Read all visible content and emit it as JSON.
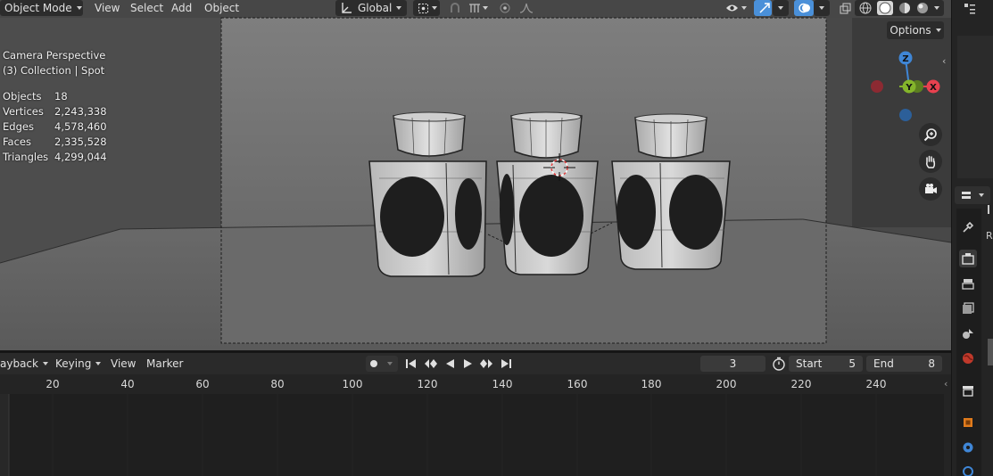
{
  "header": {
    "mode": "Object Mode",
    "menus": [
      "View",
      "Select",
      "Add",
      "Object"
    ],
    "transform_orientation": "Global"
  },
  "viewport": {
    "camera_label": "Camera Perspective",
    "collection_label": "(3) Collection | Spot",
    "options_label": "Options",
    "stats": [
      {
        "k": "Objects",
        "v": "18"
      },
      {
        "k": "Vertices",
        "v": "2,243,338"
      },
      {
        "k": "Edges",
        "v": "4,578,460"
      },
      {
        "k": "Faces",
        "v": "2,335,528"
      },
      {
        "k": "Triangles",
        "v": "4,299,044"
      }
    ],
    "gizmo": {
      "z": "Z",
      "y": "Y",
      "x": "X"
    }
  },
  "timeline": {
    "menus": [
      "ayback",
      "Keying",
      "View",
      "Marker"
    ],
    "current_frame": "3",
    "start_label": "Start",
    "start": "5",
    "end_label": "End",
    "end": "8",
    "ruler": [
      "20",
      "40",
      "60",
      "80",
      "100",
      "120",
      "140",
      "160",
      "180",
      "200",
      "220",
      "240"
    ]
  },
  "right_strip": {
    "partial_label": "R"
  },
  "colors": {
    "accent_blue": "#4a90d9",
    "axis_x": "#e8414f",
    "axis_y": "#84b52b",
    "axis_z": "#3f86d6"
  },
  "icons": [
    "transform-orientation-icon",
    "pivot-icon",
    "snap-icon",
    "proportional-icon",
    "visibility-icon",
    "gizmo-icon",
    "overlay-icon",
    "xray-icon",
    "wireframe-shading-icon",
    "solid-shading-icon",
    "material-shading-icon",
    "rendered-shading-icon",
    "zoom-icon",
    "pan-hand-icon",
    "camera-view-icon",
    "tool-icon",
    "render-icon",
    "output-icon",
    "view-layer-icon",
    "scene-icon",
    "world-icon",
    "collection-icon",
    "object-icon",
    "modifier-icon",
    "physics-icon"
  ]
}
